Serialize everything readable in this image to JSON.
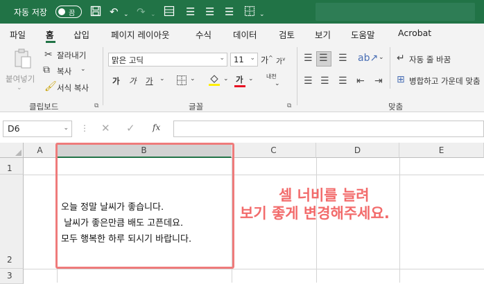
{
  "titlebar": {
    "autosave_label": "자동 저장",
    "toggle_label": "끔"
  },
  "menu": {
    "tabs": [
      "파일",
      "홈",
      "삽입",
      "페이지 레이아웃",
      "수식",
      "데이터",
      "검토",
      "보기",
      "도움말",
      "Acrobat"
    ],
    "active": "홈"
  },
  "ribbon": {
    "clipboard": {
      "paste": "붙여넣기",
      "cut": "잘라내기",
      "copy": "복사",
      "format_painter": "서식 복사",
      "group_label": "클립보드"
    },
    "font": {
      "font_name": "맑은 고딕",
      "font_size": "11",
      "bold": "가",
      "italic": "가",
      "underline": "가",
      "grow": "가",
      "shrink": "가",
      "font_color": "가",
      "phonetic": "내천",
      "group_label": "글꼴",
      "font_color_hex": "#e81123",
      "fill_color_hex": "#ffef00"
    },
    "alignment": {
      "wrap_text": "자동 줄 바꿈",
      "merge_center": "병합하고 가운데 맞춤",
      "group_label": "맞춤"
    }
  },
  "formula_bar": {
    "name_box": "D6",
    "fx": "fx",
    "formula": ""
  },
  "sheet": {
    "columns": [
      "A",
      "B",
      "C",
      "D",
      "E"
    ],
    "selected_column": "B",
    "rows": [
      "1",
      "2",
      "3"
    ],
    "cell_b2_lines": [
      "오늘 정말 날씨가 좋습니다.",
      " 날씨가 좋은만큼 배도 고픈데요.",
      "모두 행복한 하루 되시기 바랍니다."
    ]
  },
  "annotation": {
    "line1": "셀 너비를 늘려",
    "line2": "보기 좋게 변경해주세요.",
    "color": "#f26b6b"
  }
}
